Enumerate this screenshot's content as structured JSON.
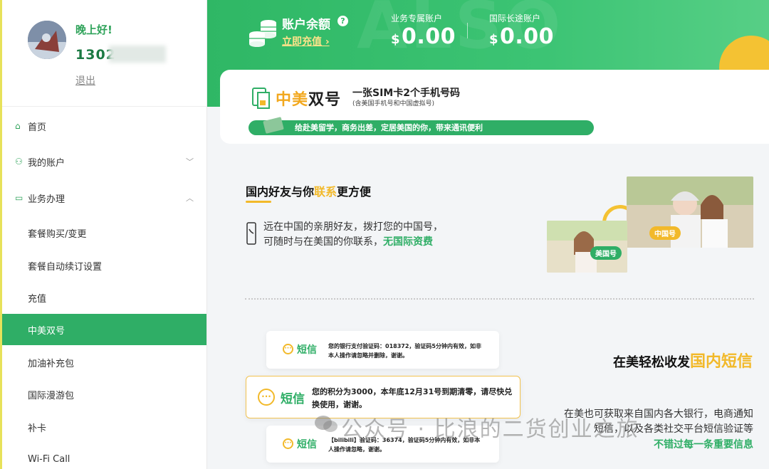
{
  "user": {
    "greeting": "晚上好!",
    "phone_visible": "1302",
    "logout": "退出"
  },
  "nav": {
    "home": "首页",
    "account": "我的账户",
    "business": "业务办理",
    "sub": [
      "套餐购买/变更",
      "套餐自动续订设置",
      "充值",
      "中美双号",
      "加油补充包",
      "国际漫游包",
      "补卡",
      "Wi-Fi Call"
    ],
    "active": "中美双号"
  },
  "header": {
    "balance_label": "账户余额",
    "help": "?",
    "recharge": "立即充值 ›",
    "accounts": [
      {
        "label": "业务专属账户",
        "currency": "$",
        "amount": "0.00"
      },
      {
        "label": "国际长途账户",
        "currency": "$",
        "amount": "0.00"
      }
    ]
  },
  "banner": {
    "title_a": "中美",
    "title_b": "双号",
    "tag1": "一张SIM卡2个手机号码",
    "tag2": "(含美国手机号和中国虚拟号)",
    "strip": "给赴美留学，商务出差，定居美国的你，带来通讯便利"
  },
  "section1": {
    "title_a": "国内好友与你",
    "title_hl": "联系",
    "title_b": "更方便",
    "line1": "远在中国的亲朋好友，拨打您的中国号，",
    "line2": "可随时与在美国的你联系，",
    "line2_hl": "无国际资费",
    "badge_cn": "中国号",
    "badge_us": "美国号"
  },
  "section2": {
    "title_a": "在美轻松收发",
    "title_hl": "国内短信",
    "line1": "在美也可获取来自国内各大银行，电商通知",
    "line2": "短信，以及各类社交平台短信验证等",
    "highlight": "不错过每一条重要信息",
    "sms_label": "短信",
    "sms1": "您的银行支付验证码：018372，验证码5分钟内有效，如非本人操作请忽略并删除，谢谢。",
    "sms2": "您的积分为3000，本年底12月31号到期清零，请尽快兑换使用，谢谢。",
    "sms3": "【bilibili】验证码：36374，验证码5分钟内有效，如非本人操作请忽略，谢谢。"
  },
  "watermark": "公众号 · 比浪的二货创业之旅",
  "colors": {
    "brand": "#2fae66",
    "accent": "#f2b92a"
  }
}
